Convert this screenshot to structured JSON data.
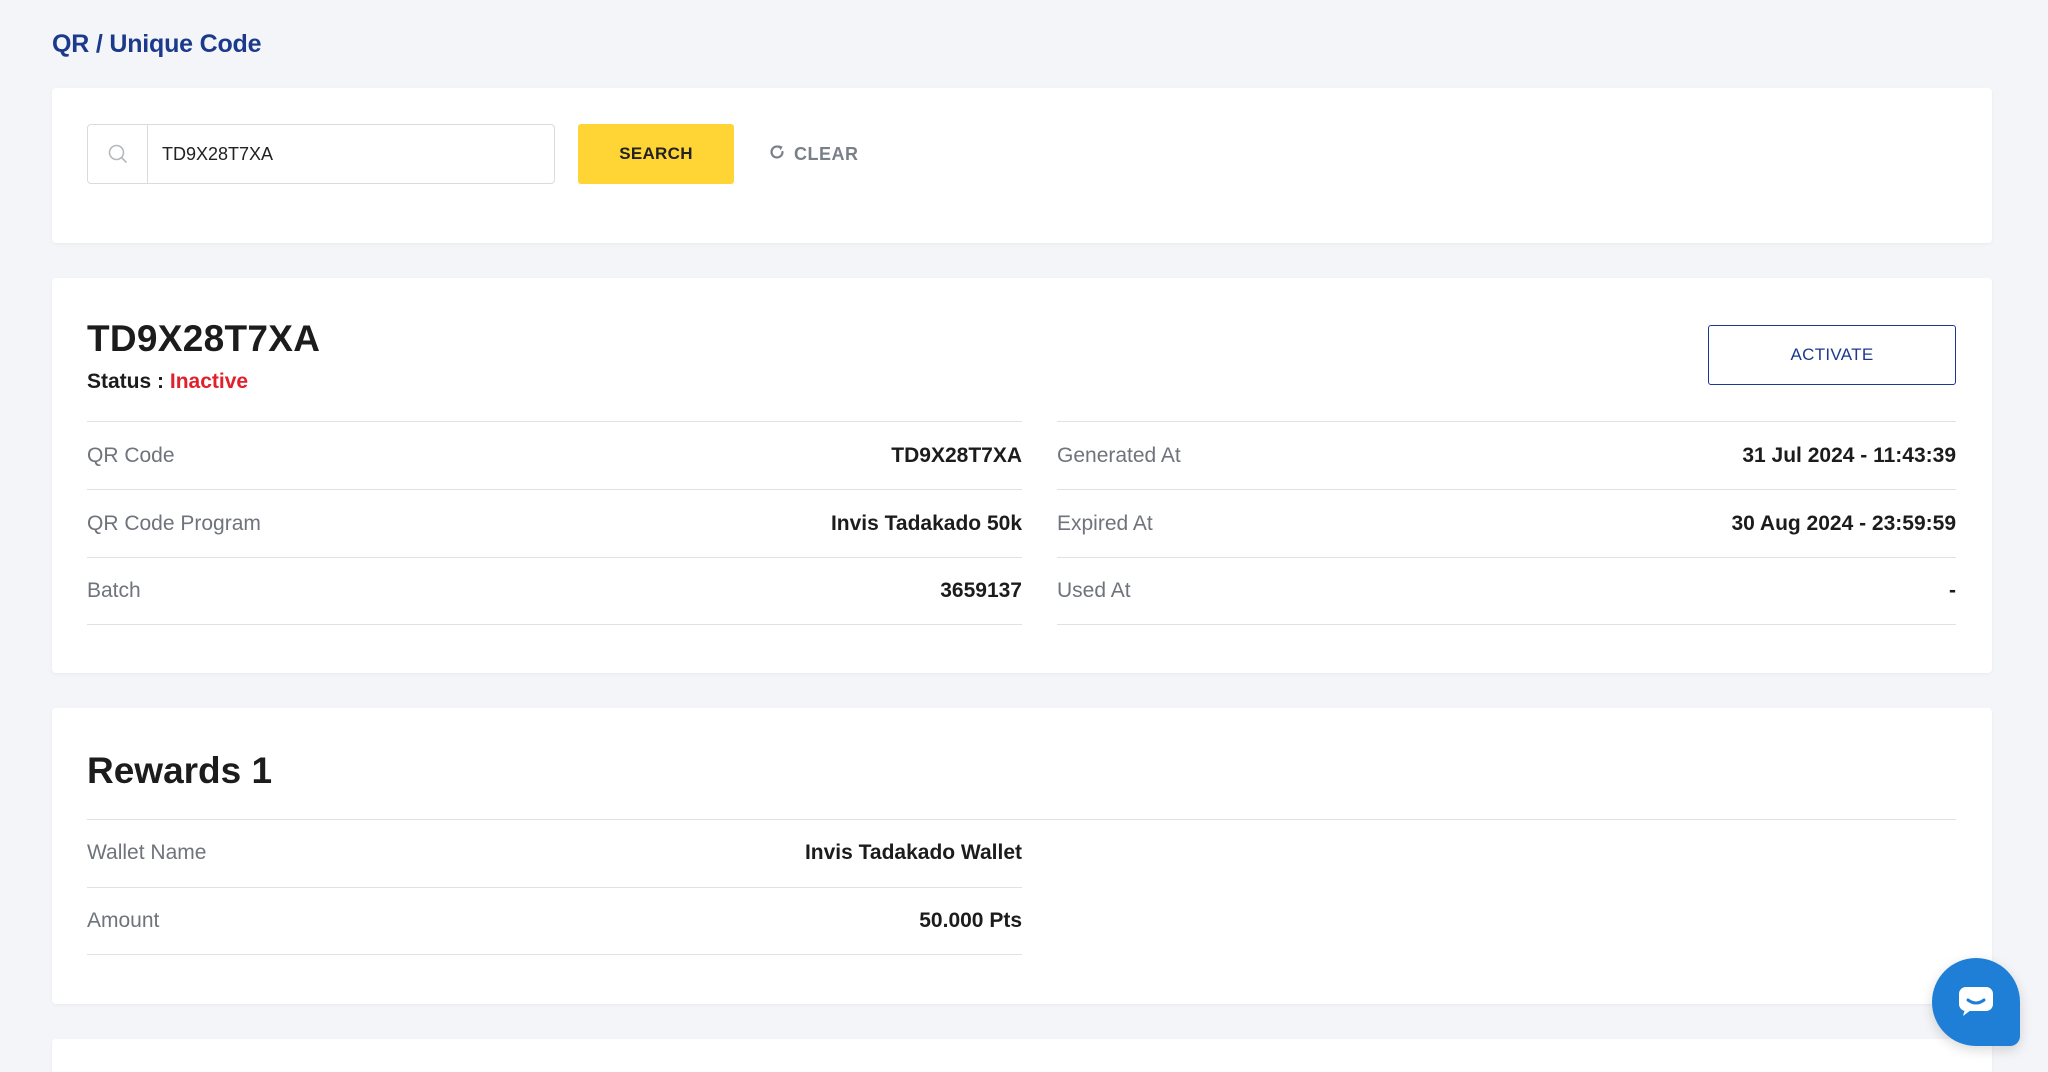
{
  "page": {
    "title": "QR / Unique Code"
  },
  "search": {
    "value": "TD9X28T7XA",
    "search_label": "SEARCH",
    "clear_label": "CLEAR",
    "icon": "search-icon",
    "clear_icon": "refresh-icon"
  },
  "detail": {
    "code": "TD9X28T7XA",
    "status_label": "Status :",
    "status_value": "Inactive",
    "activate_label": "ACTIVATE",
    "left_rows": [
      {
        "label": "QR Code",
        "value": "TD9X28T7XA"
      },
      {
        "label": "QR Code Program",
        "value": "Invis Tadakado 50k"
      },
      {
        "label": "Batch",
        "value": "3659137"
      }
    ],
    "right_rows": [
      {
        "label": "Generated At",
        "value": "31 Jul 2024 - 11:43:39"
      },
      {
        "label": "Expired At",
        "value": "30 Aug 2024 - 23:59:59"
      },
      {
        "label": "Used At",
        "value": "-"
      }
    ]
  },
  "rewards": {
    "title": "Rewards 1",
    "rows": [
      {
        "label": "Wallet Name",
        "value": "Invis Tadakado Wallet"
      },
      {
        "label": "Amount",
        "value": "50.000 Pts"
      }
    ]
  },
  "chat": {
    "icon": "chat-icon"
  },
  "colors": {
    "brand": "#1b3a8c",
    "search_button": "#ffd535",
    "status_inactive": "#e0202a",
    "chat": "#1f7fd6"
  }
}
